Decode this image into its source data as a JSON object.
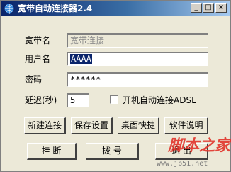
{
  "window": {
    "title": "宽带自动连接器2.4",
    "caption_buttons": {
      "minimize": "_",
      "maximize": "□",
      "close": "×"
    }
  },
  "form": {
    "account_name": {
      "label": "宽带名",
      "value": "宽带连接"
    },
    "username": {
      "label": "用户名",
      "value": "AAAA"
    },
    "password": {
      "label": "密码",
      "value": "******"
    },
    "delay": {
      "label": "延迟(秒)",
      "value": "5"
    },
    "autostart": {
      "label": "开机自动连接ADSL",
      "checked": false
    }
  },
  "buttons": {
    "new_connection": "新建连接",
    "save_settings": "保存设置",
    "desktop_shortcut": "桌面快捷",
    "software_help": "软件说明",
    "hang_up": "挂 断",
    "dial": "拨 号",
    "exit": "退 出"
  },
  "watermark": {
    "brand": "脚本之家",
    "url": "www.jb51.net"
  },
  "colors": {
    "titlebar_start": "#0a246a",
    "titlebar_end": "#a6caf0",
    "window_face": "#ece9d8",
    "watermark": "#e2342b"
  }
}
